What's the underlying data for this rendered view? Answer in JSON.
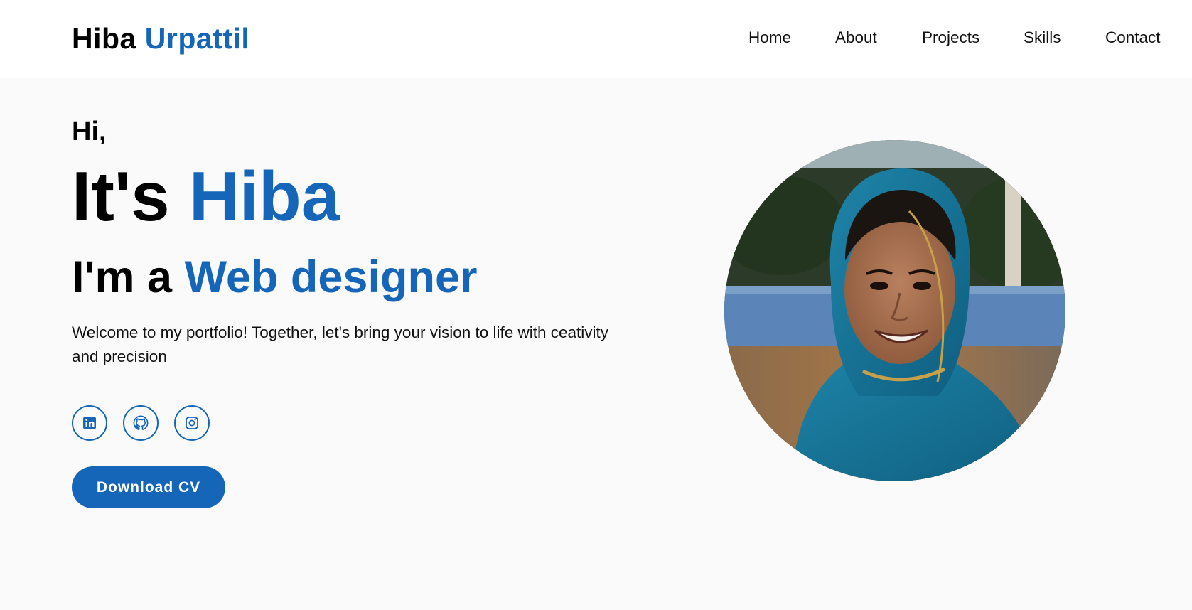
{
  "brand": {
    "first": "Hiba",
    "last": "Urpattil",
    "accent_color": "#1565b8"
  },
  "nav": [
    {
      "label": "Home"
    },
    {
      "label": "About"
    },
    {
      "label": "Projects"
    },
    {
      "label": "Skills"
    },
    {
      "label": "Contact"
    }
  ],
  "hero": {
    "greeting": "Hi,",
    "title_prefix": "It's",
    "title_name": "Hiba",
    "role_prefix": "I'm a",
    "role": "Web designer",
    "intro": "Welcome to my portfolio! Together, let's bring your vision to life with ceativity and precision",
    "socials": [
      {
        "icon": "linkedin-icon"
      },
      {
        "icon": "github-icon"
      },
      {
        "icon": "instagram-icon"
      }
    ],
    "cta_label": "Download CV"
  },
  "photo": {
    "icon": "profile-photo"
  }
}
